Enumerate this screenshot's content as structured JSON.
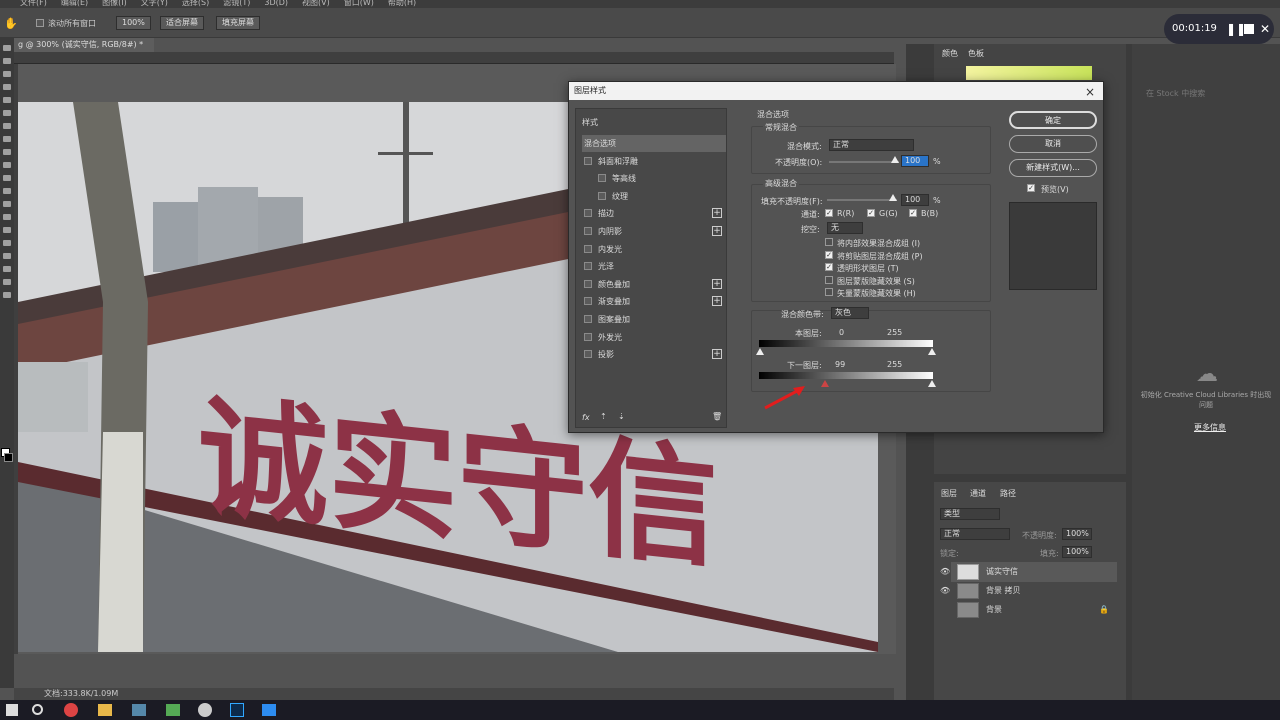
{
  "menu": [
    "文件(F)",
    "编辑(E)",
    "图像(I)",
    "文字(Y)",
    "选择(S)",
    "滤镜(T)",
    "3D(D)",
    "视图(V)",
    "窗口(W)",
    "帮助(H)"
  ],
  "options_bar": {
    "scroll_all": "滚动所有窗口",
    "zoom": "100%",
    "fit_screen": "适合屏幕",
    "fill_screen": "填充屏幕"
  },
  "document": {
    "tab_title": "g @ 300% (诚实守信, RGB/8#) *",
    "status": "文档:333.8K/1.09M"
  },
  "photo_text": "诚实守信",
  "recording": {
    "time": "00:01:19"
  },
  "color_panel": {
    "tabs": [
      "颜色",
      "色板"
    ]
  },
  "libraries": {
    "message": "初始化 Creative Cloud Libraries 时出现问题",
    "more_info": "更多信息",
    "search_placeholder": "在 Stock 中搜索"
  },
  "layers_panel": {
    "tabs": [
      "图层",
      "通道",
      "路径"
    ],
    "kind": "类型",
    "blend": "正常",
    "opacity_label": "不透明度:",
    "opacity": "100%",
    "lock_label": "锁定:",
    "fill_label": "填充:",
    "fill": "100%",
    "layers": [
      {
        "name": "诚实守信",
        "selected": true
      },
      {
        "name": "背景 拷贝",
        "selected": false
      },
      {
        "name": "背景",
        "selected": false
      }
    ]
  },
  "dialog": {
    "title": "图层样式",
    "styles_header": "样式",
    "styles": [
      {
        "label": "混合选项",
        "active": true,
        "checkbox": false,
        "plus": false,
        "indent": 0
      },
      {
        "label": "斜面和浮雕",
        "active": false,
        "checkbox": true,
        "plus": false,
        "indent": 0
      },
      {
        "label": "等高线",
        "active": false,
        "checkbox": true,
        "plus": false,
        "indent": 1
      },
      {
        "label": "纹理",
        "active": false,
        "checkbox": true,
        "plus": false,
        "indent": 1
      },
      {
        "label": "描边",
        "active": false,
        "checkbox": true,
        "plus": true,
        "indent": 0
      },
      {
        "label": "内阴影",
        "active": false,
        "checkbox": true,
        "plus": true,
        "indent": 0
      },
      {
        "label": "内发光",
        "active": false,
        "checkbox": true,
        "plus": false,
        "indent": 0
      },
      {
        "label": "光泽",
        "active": false,
        "checkbox": true,
        "plus": false,
        "indent": 0
      },
      {
        "label": "颜色叠加",
        "active": false,
        "checkbox": true,
        "plus": true,
        "indent": 0
      },
      {
        "label": "渐变叠加",
        "active": false,
        "checkbox": true,
        "plus": true,
        "indent": 0
      },
      {
        "label": "图案叠加",
        "active": false,
        "checkbox": true,
        "plus": false,
        "indent": 0
      },
      {
        "label": "外发光",
        "active": false,
        "checkbox": true,
        "plus": false,
        "indent": 0
      },
      {
        "label": "投影",
        "active": false,
        "checkbox": true,
        "plus": true,
        "indent": 0
      }
    ],
    "blend_options": "混合选项",
    "general_blending": "常规混合",
    "blend_mode_label": "混合模式:",
    "blend_mode": "正常",
    "opacity_label": "不透明度(O):",
    "opacity": "100",
    "percent": "%",
    "advanced_blending": "高级混合",
    "fill_opacity_label": "填充不透明度(F):",
    "fill_opacity": "100",
    "channels_label": "通道:",
    "channels": [
      "R(R)",
      "G(G)",
      "B(B)"
    ],
    "knockout_label": "挖空:",
    "knockout": "无",
    "options": [
      {
        "label": "将内部效果混合成组 (I)",
        "checked": false
      },
      {
        "label": "将剪贴图层混合成组 (P)",
        "checked": true
      },
      {
        "label": "透明形状图层 (T)",
        "checked": true
      },
      {
        "label": "图层蒙版隐藏效果 (S)",
        "checked": false
      },
      {
        "label": "矢量蒙版隐藏效果 (H)",
        "checked": false
      }
    ],
    "blend_if_label": "混合颜色带:",
    "blend_if": "灰色",
    "this_layer": "本图层:",
    "this_layer_low": "0",
    "this_layer_high": "255",
    "under_layer": "下一图层:",
    "under_layer_low": "99",
    "under_layer_high": "255",
    "buttons": {
      "ok": "确定",
      "cancel": "取消",
      "new_style": "新建样式(W)...",
      "preview": "预览(V)"
    },
    "fx": "fx"
  }
}
